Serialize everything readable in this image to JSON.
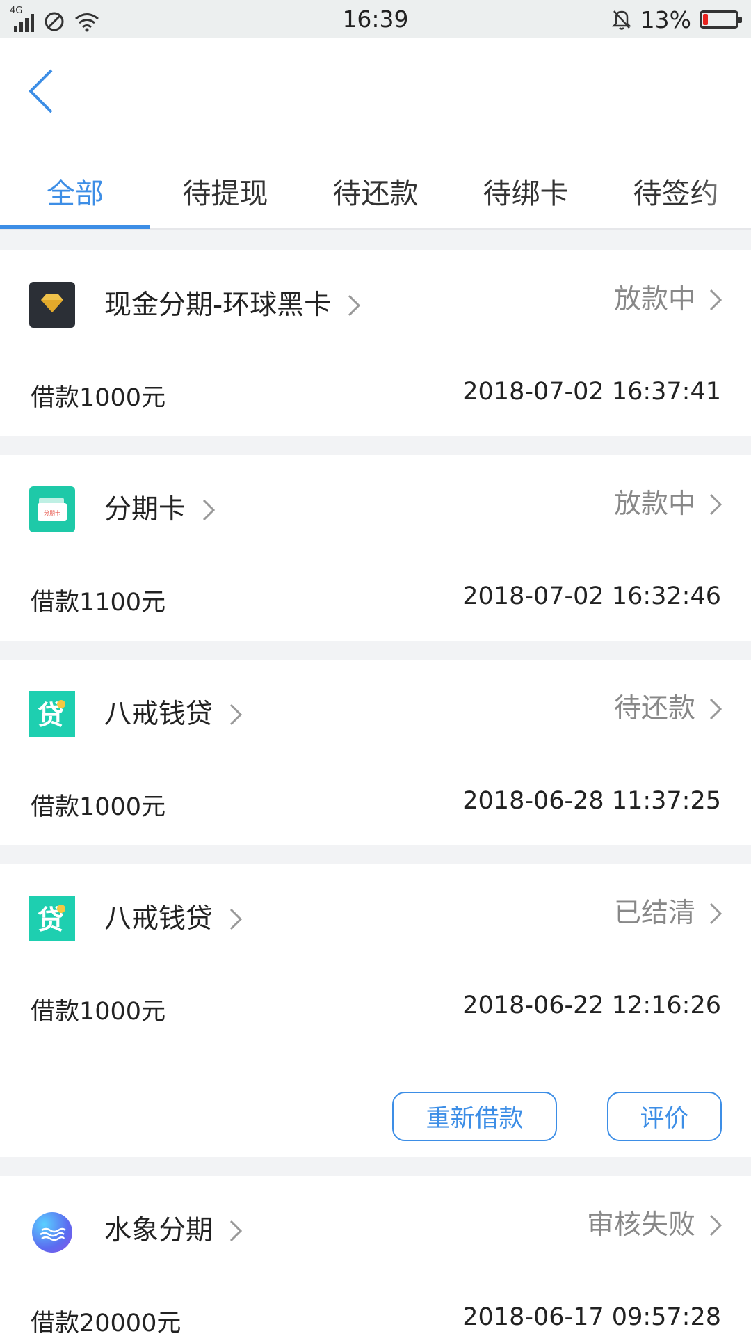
{
  "status_bar": {
    "network": "4G",
    "time": "16:39",
    "battery_pct": "13%",
    "battery_level": 0.13
  },
  "nav": {
    "back_icon": "chevron-left-icon"
  },
  "tabs": [
    {
      "label": "全部",
      "active": true
    },
    {
      "label": "待提现",
      "active": false
    },
    {
      "label": "待还款",
      "active": false
    },
    {
      "label": "待绑卡",
      "active": false
    },
    {
      "label": "待签约",
      "active": false
    }
  ],
  "loans": [
    {
      "name": "现金分期-环球黑卡",
      "status": "放款中",
      "amount": "借款1000元",
      "date": "2018-07-02 16:37:41",
      "icon": "diamond-icon"
    },
    {
      "name": "分期卡",
      "status": "放款中",
      "amount": "借款1100元",
      "date": "2018-07-02 16:32:46",
      "icon": "card-icon",
      "icon_text": "分期卡"
    },
    {
      "name": "八戒钱贷",
      "status": "待还款",
      "amount": "借款1000元",
      "date": "2018-06-28 11:37:25",
      "icon": "dai-icon",
      "icon_text": "贷"
    },
    {
      "name": "八戒钱贷",
      "status": "已结清",
      "amount": "借款1000元",
      "date": "2018-06-22 12:16:26",
      "icon": "dai-icon",
      "icon_text": "贷",
      "actions": {
        "reborrow": "重新借款",
        "review": "评价"
      }
    },
    {
      "name": "水象分期",
      "status": "审核失败",
      "amount": "借款20000元",
      "date": "2018-06-17 09:57:28",
      "icon": "wave-icon"
    }
  ],
  "colors": {
    "accent": "#3d8ee6",
    "teal": "#1ec9a8",
    "battery_low": "#e8231e"
  }
}
